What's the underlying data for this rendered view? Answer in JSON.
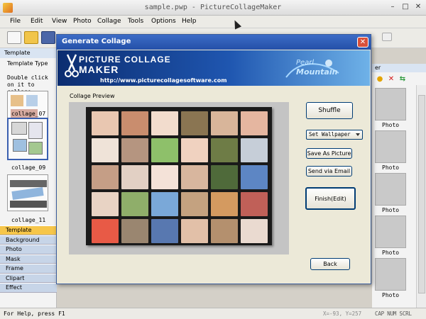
{
  "window": {
    "title": "sample.pwp - PictureCollageMaker"
  },
  "menu": [
    "File",
    "Edit",
    "View",
    "Photo",
    "Collage",
    "Tools",
    "Options",
    "Help"
  ],
  "left_panel": {
    "title": "Template",
    "type_label": "Template Type",
    "instructions": "Double click on it to collage",
    "templates": [
      "collage_07",
      "collage_09",
      "collage_11"
    ],
    "nav_tabs": [
      "Template",
      "Background",
      "Photo",
      "Mask",
      "Frame",
      "Clipart",
      "Effect"
    ],
    "active_tab": "Template",
    "more": "»"
  },
  "right_panel": {
    "header": "er",
    "photo_labels": [
      "Photo",
      "Photo",
      "Photo",
      "Photo",
      "Photo"
    ]
  },
  "status": {
    "help": "For Help, press F1",
    "coords": "X=-93, Y=257",
    "keys": "CAP NUM SCRL"
  },
  "dialog": {
    "title": "Generate Collage",
    "logo_line1": "PICTURE COLLAGE",
    "logo_line2": "MAKER",
    "url": "http://www.picturecollagesoftware.com",
    "brand_line1": "Pearl",
    "brand_line2": "Mountain",
    "preview_label": "Collage Preview",
    "buttons": {
      "shuffle": "Shuffle",
      "wallpaper": "Set Wallpaper",
      "save_picture": "Save As Picture",
      "send_email": "Send via Email",
      "finish": "Finish(Edit)",
      "back": "Back"
    }
  },
  "colors": {
    "dialog_title_bg": "#2c5bb8",
    "banner_dark": "#0c2d70",
    "active_tab": "#f6c64a",
    "inactive_tab": "#c7d5e8"
  }
}
